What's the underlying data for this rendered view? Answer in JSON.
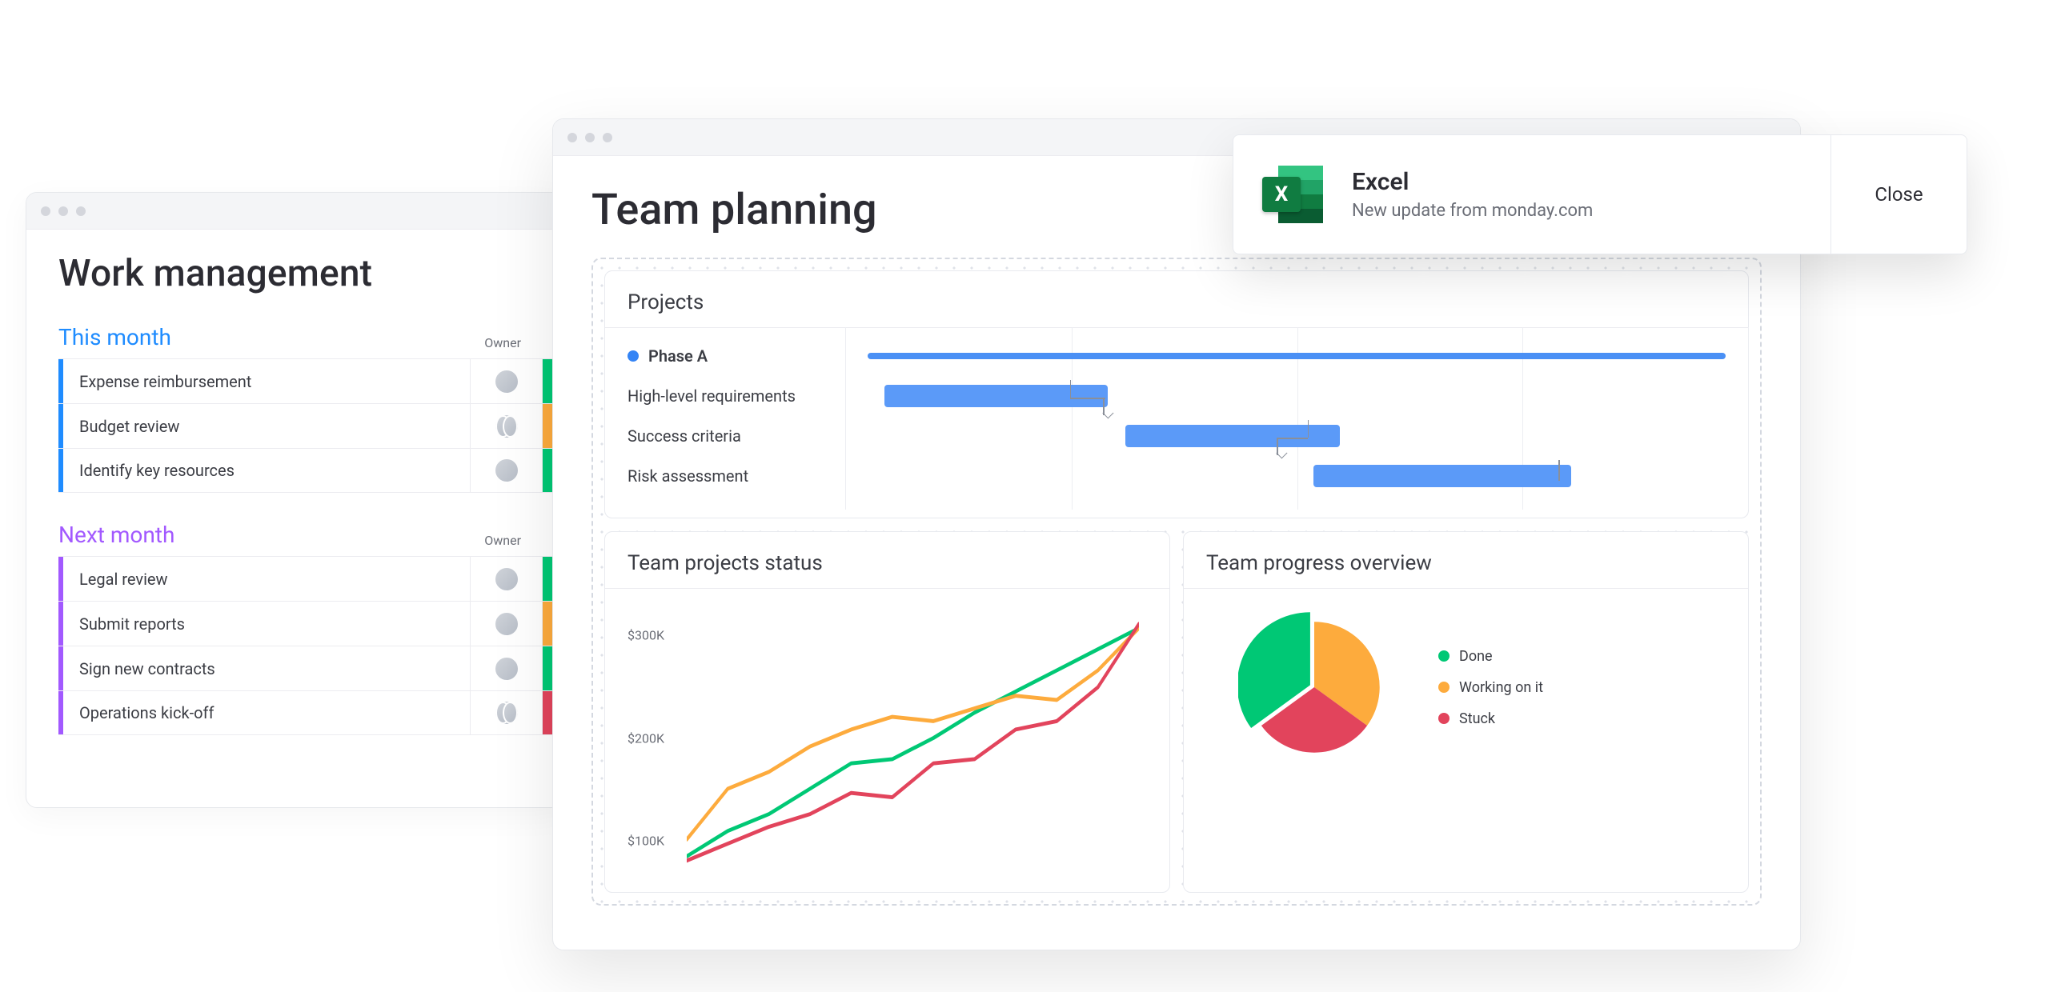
{
  "work_management": {
    "title": "Work management",
    "groups": [
      {
        "title": "This month",
        "color": "blue",
        "owner_label": "Owner",
        "rows": [
          {
            "text": "Expense reimbursement",
            "avatar": "single",
            "status": "green"
          },
          {
            "text": "Budget review",
            "avatar": "pair",
            "status": "orange"
          },
          {
            "text": "Identify key resources",
            "avatar": "single",
            "status": "green"
          }
        ]
      },
      {
        "title": "Next month",
        "color": "purple",
        "owner_label": "Owner",
        "rows": [
          {
            "text": "Legal review",
            "avatar": "single",
            "status": "green"
          },
          {
            "text": "Submit reports",
            "avatar": "single",
            "status": "orange"
          },
          {
            "text": "Sign new contracts",
            "avatar": "single",
            "status": "green"
          },
          {
            "text": "Operations kick-off",
            "avatar": "pair",
            "status": "red"
          }
        ]
      }
    ]
  },
  "team_planning": {
    "title": "Team planning",
    "projects_panel": {
      "title": "Projects",
      "phase_label": "Phase A",
      "tasks": [
        {
          "label": "High-level requirements"
        },
        {
          "label": "Success criteria"
        },
        {
          "label": "Risk assessment"
        }
      ]
    },
    "status_panel": {
      "title": "Team projects status",
      "y_ticks": [
        "$300K",
        "$200K",
        "$100K"
      ]
    },
    "progress_panel": {
      "title": "Team progress overview",
      "legend": [
        {
          "label": "Done",
          "color": "#00c875"
        },
        {
          "label": "Working on it",
          "color": "#fdab3d"
        },
        {
          "label": "Stuck",
          "color": "#e2445c"
        }
      ]
    }
  },
  "toast": {
    "title": "Excel",
    "subtitle": "New update from monday.com",
    "close": "Close",
    "badge": "X"
  },
  "status_colors": {
    "green": "#00c875",
    "orange": "#fdab3d",
    "red": "#e2445c"
  },
  "chart_data": [
    {
      "type": "bar",
      "name": "projects_gantt",
      "title": "Projects",
      "series": [
        {
          "name": "Phase A",
          "start": 0,
          "end": 100,
          "thin": true
        },
        {
          "name": "High-level requirements",
          "start": 2,
          "end": 28
        },
        {
          "name": "Success criteria",
          "start": 30,
          "end": 55
        },
        {
          "name": "Risk assessment",
          "start": 52,
          "end": 82
        }
      ],
      "xlim": [
        0,
        100
      ]
    },
    {
      "type": "line",
      "name": "team_projects_status",
      "title": "Team projects status",
      "ylabel": "USD",
      "ylim": [
        50,
        350
      ],
      "x": [
        0,
        1,
        2,
        3,
        4,
        5,
        6,
        7,
        8,
        9,
        10,
        11
      ],
      "series": [
        {
          "name": "green",
          "color": "#00c875",
          "values": [
            60,
            90,
            110,
            140,
            170,
            175,
            200,
            230,
            255,
            280,
            305,
            330
          ]
        },
        {
          "name": "orange",
          "color": "#fdab3d",
          "values": [
            80,
            140,
            160,
            190,
            210,
            225,
            220,
            235,
            250,
            245,
            280,
            330
          ]
        },
        {
          "name": "red",
          "color": "#e2445c",
          "values": [
            55,
            75,
            95,
            110,
            135,
            130,
            170,
            175,
            210,
            220,
            260,
            335
          ]
        }
      ]
    },
    {
      "type": "pie",
      "name": "team_progress_overview",
      "title": "Team progress overview",
      "categories": [
        "Done",
        "Working on it",
        "Stuck"
      ],
      "values": [
        35,
        35,
        30
      ],
      "colors": [
        "#00c875",
        "#fdab3d",
        "#e2445c"
      ]
    }
  ]
}
